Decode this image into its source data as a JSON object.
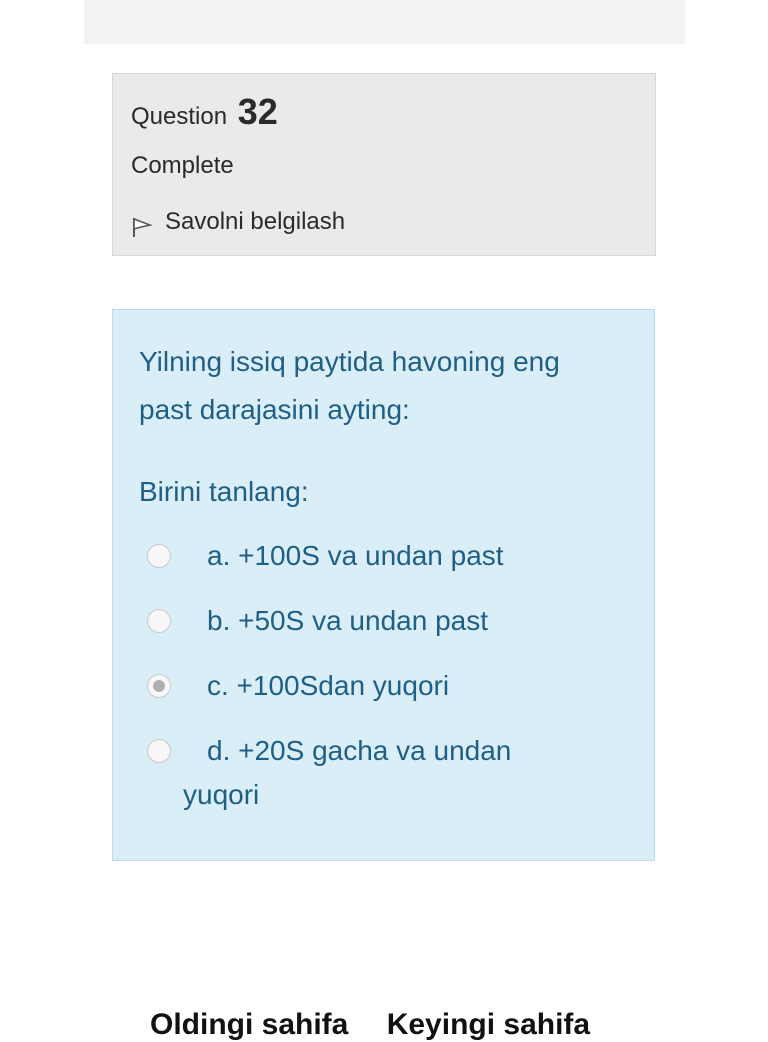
{
  "info": {
    "question_label": "Question",
    "question_number": "32",
    "state": "Complete",
    "flag_label": "Savolni belgilash"
  },
  "question": {
    "text": "Yilning issiq paytida havoning eng past darajasini ayting:",
    "prompt": "Birini tanlang:",
    "options": [
      {
        "label": "a. +100S va undan past",
        "selected": false
      },
      {
        "label": "b. +50S va undan past",
        "selected": false
      },
      {
        "label": "c. +100Sdan yuqori",
        "selected": true
      },
      {
        "label": "d. +20S gacha va undan",
        "label_cont": "yuqori",
        "selected": false
      }
    ]
  },
  "nav": {
    "prev_label": "Oldingi sahifa",
    "next_label": "Keyingi sahifa"
  },
  "colors": {
    "question_bg": "#daeef8",
    "question_text": "#1f5f86",
    "info_bg": "#e9eaec"
  }
}
